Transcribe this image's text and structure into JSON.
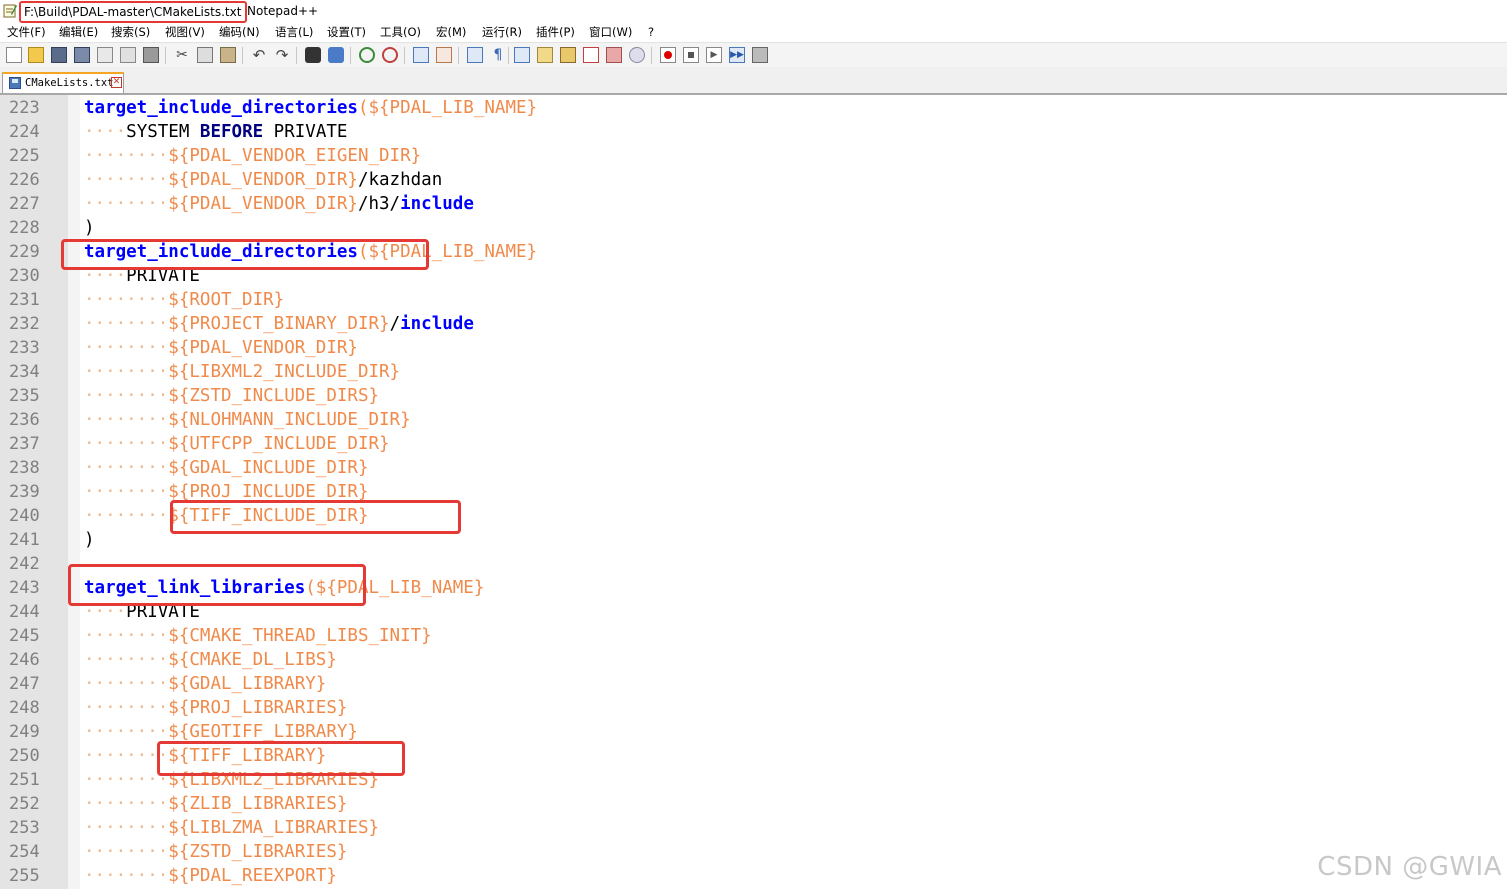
{
  "window": {
    "file_path": "F:\\Build\\PDAL-master\\CMakeLists.txt",
    "app_name": "Notepad++"
  },
  "menu": [
    {
      "label": "文件(F)"
    },
    {
      "label": "编辑(E)"
    },
    {
      "label": "搜索(S)"
    },
    {
      "label": "视图(V)"
    },
    {
      "label": "编码(N)"
    },
    {
      "label": "语言(L)"
    },
    {
      "label": "设置(T)"
    },
    {
      "label": "工具(O)"
    },
    {
      "label": "宏(M)"
    },
    {
      "label": "运行(R)"
    },
    {
      "label": "插件(P)"
    },
    {
      "label": "窗口(W)"
    },
    {
      "label": "?"
    }
  ],
  "toolbar": [
    {
      "icon": "new-file-icon"
    },
    {
      "icon": "open-file-icon"
    },
    {
      "icon": "save-icon"
    },
    {
      "icon": "save-all-icon"
    },
    {
      "icon": "close-icon"
    },
    {
      "icon": "close-all-icon"
    },
    {
      "icon": "print-icon"
    },
    {
      "icon": "cut-icon"
    },
    {
      "icon": "copy-icon"
    },
    {
      "icon": "paste-icon"
    },
    {
      "icon": "undo-icon"
    },
    {
      "icon": "redo-icon"
    },
    {
      "icon": "find-icon"
    },
    {
      "icon": "replace-icon"
    },
    {
      "icon": "zoom-in-icon"
    },
    {
      "icon": "zoom-out-icon"
    },
    {
      "icon": "sync-vertical-icon"
    },
    {
      "icon": "sync-horizontal-icon"
    },
    {
      "icon": "word-wrap-icon"
    },
    {
      "icon": "show-all-chars-icon"
    },
    {
      "icon": "indent-guide-icon"
    },
    {
      "icon": "language-icon"
    },
    {
      "icon": "doc-map-icon"
    },
    {
      "icon": "function-list-icon"
    },
    {
      "icon": "folder-workspace-icon"
    },
    {
      "icon": "monitor-icon"
    },
    {
      "icon": "record-macro-icon"
    },
    {
      "icon": "stop-macro-icon"
    },
    {
      "icon": "play-macro-icon"
    },
    {
      "icon": "play-multiple-macro-icon"
    },
    {
      "icon": "save-macro-icon"
    }
  ],
  "tab": {
    "label": "CMakeLists.txt"
  },
  "code_lines": [
    {
      "n": "223",
      "tokens": [
        [
          "kw",
          "target_include_directories"
        ],
        [
          "var",
          "(${PDAL_LIB_NAME}"
        ]
      ]
    },
    {
      "n": "224",
      "tokens": [
        [
          "ws",
          "····"
        ],
        [
          "txt",
          "SYSTEM "
        ],
        [
          "kw2",
          "BEFORE"
        ],
        [
          "txt",
          " PRIVATE"
        ]
      ]
    },
    {
      "n": "225",
      "tokens": [
        [
          "ws",
          "········"
        ],
        [
          "var",
          "${PDAL_VENDOR_EIGEN_DIR}"
        ]
      ]
    },
    {
      "n": "226",
      "tokens": [
        [
          "ws",
          "········"
        ],
        [
          "var",
          "${PDAL_VENDOR_DIR}"
        ],
        [
          "txt",
          "/kazhdan"
        ]
      ]
    },
    {
      "n": "227",
      "tokens": [
        [
          "ws",
          "········"
        ],
        [
          "var",
          "${PDAL_VENDOR_DIR}"
        ],
        [
          "txt",
          "/h3/"
        ],
        [
          "kw",
          "include"
        ]
      ]
    },
    {
      "n": "228",
      "tokens": [
        [
          "txt",
          ")"
        ]
      ]
    },
    {
      "n": "229",
      "tokens": [
        [
          "kw",
          "target_include_directories"
        ],
        [
          "var",
          "(${PDAL_LIB_NAME}"
        ]
      ]
    },
    {
      "n": "230",
      "tokens": [
        [
          "ws",
          "····"
        ],
        [
          "txt",
          "PRIVATE"
        ]
      ]
    },
    {
      "n": "231",
      "tokens": [
        [
          "ws",
          "········"
        ],
        [
          "var",
          "${ROOT_DIR}"
        ]
      ]
    },
    {
      "n": "232",
      "tokens": [
        [
          "ws",
          "········"
        ],
        [
          "var",
          "${PROJECT_BINARY_DIR}"
        ],
        [
          "txt",
          "/"
        ],
        [
          "kw",
          "include"
        ]
      ]
    },
    {
      "n": "233",
      "tokens": [
        [
          "ws",
          "········"
        ],
        [
          "var",
          "${PDAL_VENDOR_DIR}"
        ]
      ]
    },
    {
      "n": "234",
      "tokens": [
        [
          "ws",
          "········"
        ],
        [
          "var",
          "${LIBXML2_INCLUDE_DIR}"
        ]
      ]
    },
    {
      "n": "235",
      "tokens": [
        [
          "ws",
          "········"
        ],
        [
          "var",
          "${ZSTD_INCLUDE_DIRS}"
        ]
      ]
    },
    {
      "n": "236",
      "tokens": [
        [
          "ws",
          "········"
        ],
        [
          "var",
          "${NLOHMANN_INCLUDE_DIR}"
        ]
      ]
    },
    {
      "n": "237",
      "tokens": [
        [
          "ws",
          "········"
        ],
        [
          "var",
          "${UTFCPP_INCLUDE_DIR}"
        ]
      ]
    },
    {
      "n": "238",
      "tokens": [
        [
          "ws",
          "········"
        ],
        [
          "var",
          "${GDAL_INCLUDE_DIR}"
        ]
      ]
    },
    {
      "n": "239",
      "tokens": [
        [
          "ws",
          "········"
        ],
        [
          "var",
          "${PROJ_INCLUDE_DIR}"
        ]
      ]
    },
    {
      "n": "240",
      "tokens": [
        [
          "ws",
          "········"
        ],
        [
          "var",
          "${TIFF_INCLUDE_DIR}"
        ]
      ]
    },
    {
      "n": "241",
      "tokens": [
        [
          "txt",
          ")"
        ]
      ]
    },
    {
      "n": "242",
      "tokens": []
    },
    {
      "n": "243",
      "tokens": [
        [
          "kw",
          "target_link_libraries"
        ],
        [
          "var",
          "(${PDAL_LIB_NAME}"
        ]
      ]
    },
    {
      "n": "244",
      "tokens": [
        [
          "ws",
          "····"
        ],
        [
          "txt",
          "PRIVATE"
        ]
      ]
    },
    {
      "n": "245",
      "tokens": [
        [
          "ws",
          "········"
        ],
        [
          "var",
          "${CMAKE_THREAD_LIBS_INIT}"
        ]
      ]
    },
    {
      "n": "246",
      "tokens": [
        [
          "ws",
          "········"
        ],
        [
          "var",
          "${CMAKE_DL_LIBS}"
        ]
      ]
    },
    {
      "n": "247",
      "tokens": [
        [
          "ws",
          "········"
        ],
        [
          "var",
          "${GDAL_LIBRARY}"
        ]
      ]
    },
    {
      "n": "248",
      "tokens": [
        [
          "ws",
          "········"
        ],
        [
          "var",
          "${PROJ_LIBRARIES}"
        ]
      ]
    },
    {
      "n": "249",
      "tokens": [
        [
          "ws",
          "········"
        ],
        [
          "var",
          "${GEOTIFF_LIBRARY}"
        ]
      ]
    },
    {
      "n": "250",
      "tokens": [
        [
          "ws",
          "········"
        ],
        [
          "var",
          "${TIFF_LIBRARY}"
        ]
      ]
    },
    {
      "n": "251",
      "tokens": [
        [
          "ws",
          "········"
        ],
        [
          "var",
          "${LIBXML2_LIBRARIES}"
        ]
      ]
    },
    {
      "n": "252",
      "tokens": [
        [
          "ws",
          "········"
        ],
        [
          "var",
          "${ZLIB_LIBRARIES}"
        ]
      ]
    },
    {
      "n": "253",
      "tokens": [
        [
          "ws",
          "········"
        ],
        [
          "var",
          "${LIBLZMA_LIBRARIES}"
        ]
      ]
    },
    {
      "n": "254",
      "tokens": [
        [
          "ws",
          "········"
        ],
        [
          "var",
          "${ZSTD_LIBRARIES}"
        ]
      ]
    },
    {
      "n": "255",
      "tokens": [
        [
          "ws",
          "········"
        ],
        [
          "var",
          "${PDAL_REEXPORT}"
        ]
      ]
    }
  ],
  "annotation_color": "#e53935",
  "watermark": "CSDN @GWIA"
}
